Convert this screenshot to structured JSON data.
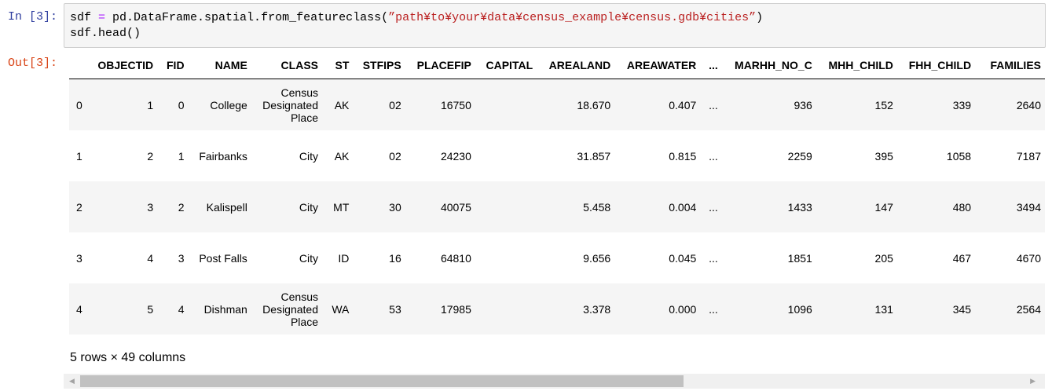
{
  "cell": {
    "in_prompt": "In [3]:",
    "out_prompt": "Out[3]:",
    "code_line1_a": "sdf ",
    "code_line1_op": "=",
    "code_line1_b": " pd.DataFrame.spatial.from_featureclass(",
    "code_line1_str": "”path¥to¥your¥data¥census_example¥census.gdb¥cities”",
    "code_line1_c": ")",
    "code_line2": "sdf.head()"
  },
  "table": {
    "columns": [
      "",
      "OBJECTID",
      "FID",
      "NAME",
      "CLASS",
      "ST",
      "STFIPS",
      "PLACEFIP",
      "CAPITAL",
      "AREALAND",
      "AREAWATER",
      "...",
      "MARHH_NO_C",
      "MHH_CHILD",
      "FHH_CHILD",
      "FAMILIES"
    ],
    "rows": [
      [
        "0",
        "1",
        "0",
        "College",
        "Census Designated Place",
        "AK",
        "02",
        "16750",
        "",
        "18.670",
        "0.407",
        "...",
        "936",
        "152",
        "339",
        "2640"
      ],
      [
        "1",
        "2",
        "1",
        "Fairbanks",
        "City",
        "AK",
        "02",
        "24230",
        "",
        "31.857",
        "0.815",
        "...",
        "2259",
        "395",
        "1058",
        "7187"
      ],
      [
        "2",
        "3",
        "2",
        "Kalispell",
        "City",
        "MT",
        "30",
        "40075",
        "",
        "5.458",
        "0.004",
        "...",
        "1433",
        "147",
        "480",
        "3494"
      ],
      [
        "3",
        "4",
        "3",
        "Post Falls",
        "City",
        "ID",
        "16",
        "64810",
        "",
        "9.656",
        "0.045",
        "...",
        "1851",
        "205",
        "467",
        "4670"
      ],
      [
        "4",
        "5",
        "4",
        "Dishman",
        "Census Designated Place",
        "WA",
        "53",
        "17985",
        "",
        "3.378",
        "0.000",
        "...",
        "1096",
        "131",
        "345",
        "2564"
      ]
    ]
  },
  "summary": "5 rows × 49 columns",
  "scrollbar": {
    "left_arrow": "◀",
    "right_arrow": "▶"
  }
}
